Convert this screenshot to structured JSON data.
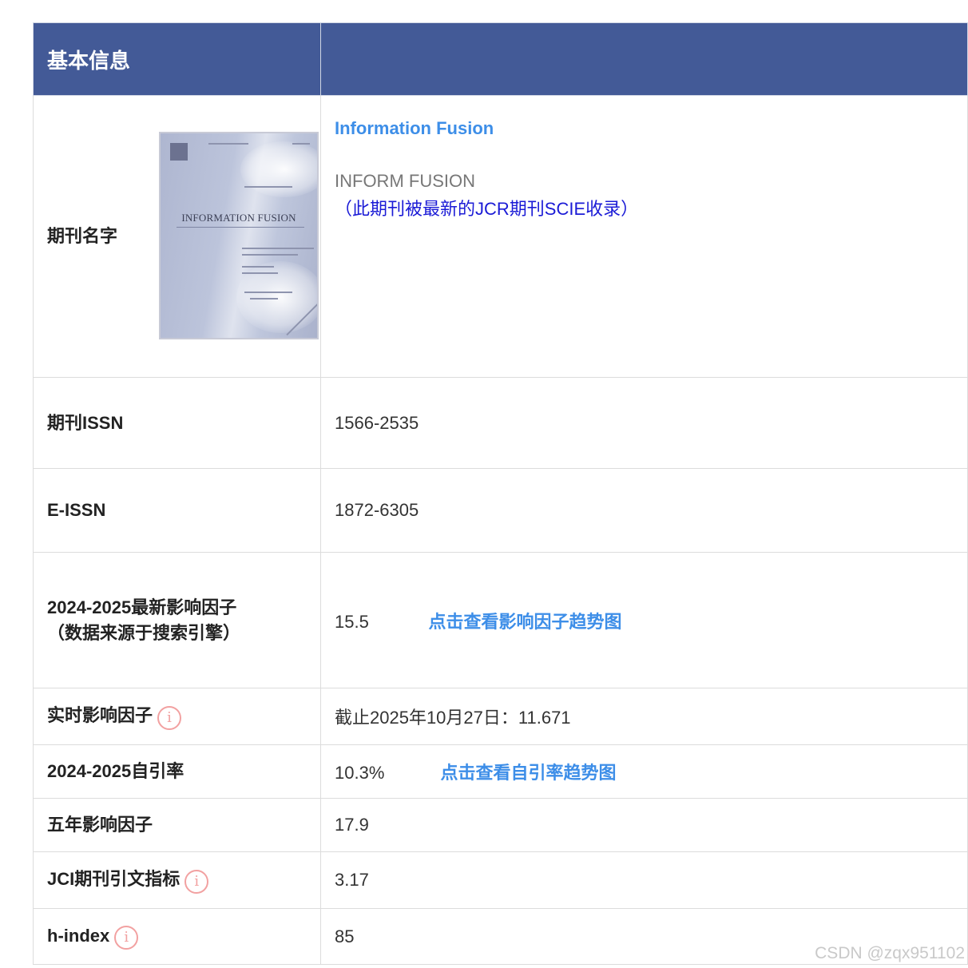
{
  "header": {
    "title": "基本信息"
  },
  "journal": {
    "label": "期刊名字",
    "cover_title": "INFORMATION FUSION",
    "name": "Information Fusion",
    "abbr": "INFORM FUSION",
    "note": "（此期刊被最新的JCR期刊SCIE收录）"
  },
  "rows": {
    "issn": {
      "label": "期刊ISSN",
      "value": "1566-2535"
    },
    "eissn": {
      "label": "E-ISSN",
      "value": "1872-6305"
    },
    "if": {
      "label_line1": "2024-2025最新影响因子",
      "label_line2": "（数据来源于搜索引擎）",
      "value": "15.5",
      "link": "点击查看影响因子趋势图"
    },
    "realtime": {
      "label": "实时影响因子",
      "value": "截止2025年10月27日：11.671"
    },
    "selfcite": {
      "label": "2024-2025自引率",
      "value": "10.3%",
      "link": "点击查看自引率趋势图"
    },
    "five_year": {
      "label": "五年影响因子",
      "value": "17.9"
    },
    "jci": {
      "label": "JCI期刊引文指标",
      "value": "3.17"
    },
    "hindex": {
      "label": "h-index",
      "value": "85"
    }
  },
  "icons": {
    "info": "info-icon",
    "info_glyph": "i"
  },
  "watermark": "CSDN @zqx951102",
  "colors": {
    "header_bg": "#435a97",
    "link": "#3d8ee8",
    "note": "#1b1bd6",
    "info_icon": "#f2a1a1"
  }
}
